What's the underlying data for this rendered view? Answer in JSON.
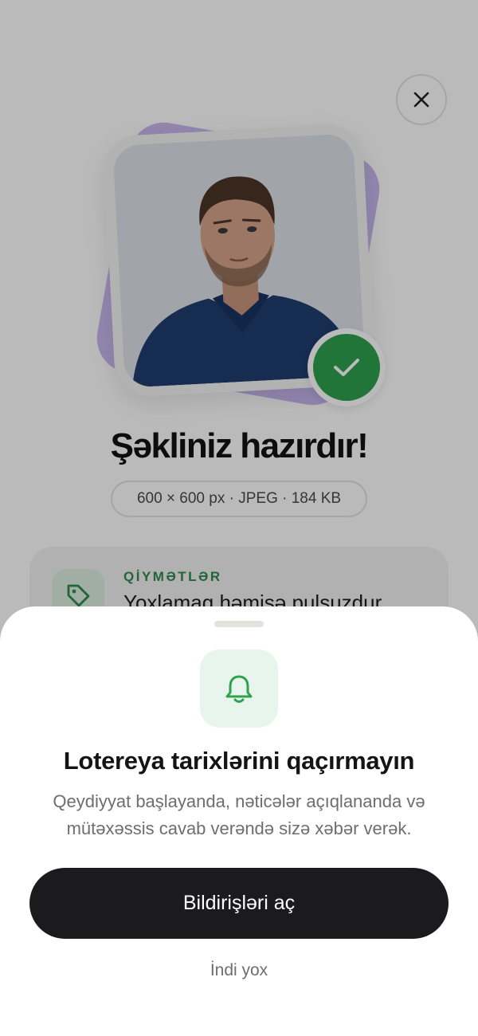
{
  "background_screen": {
    "close_icon": "close-icon",
    "title": "Şəkliniz hazırdır!",
    "photo_meta": "600 × 600 px · JPEG · 184 KB",
    "pricing_card": {
      "label": "QİYMƏTLƏR",
      "text": "Yoxlamaq həmişə pulsuzdur",
      "icon": "tag-icon"
    },
    "status_icon": "checkmark-icon"
  },
  "sheet": {
    "icon": "bell-icon",
    "title": "Lotereya tarixlərini qaçırmayın",
    "description": "Qeydiyyat başlayanda, nəticələr açıqlananda və mütəxəssis cavab verəndə sizə xəbər verək.",
    "primary_button": "Bildirişləri aç",
    "secondary_button": "İndi yox"
  },
  "colors": {
    "accent_green": "#2fa14f",
    "primary_button": "#1b1b1e",
    "photo_backdrop": "#c9b9f0"
  }
}
